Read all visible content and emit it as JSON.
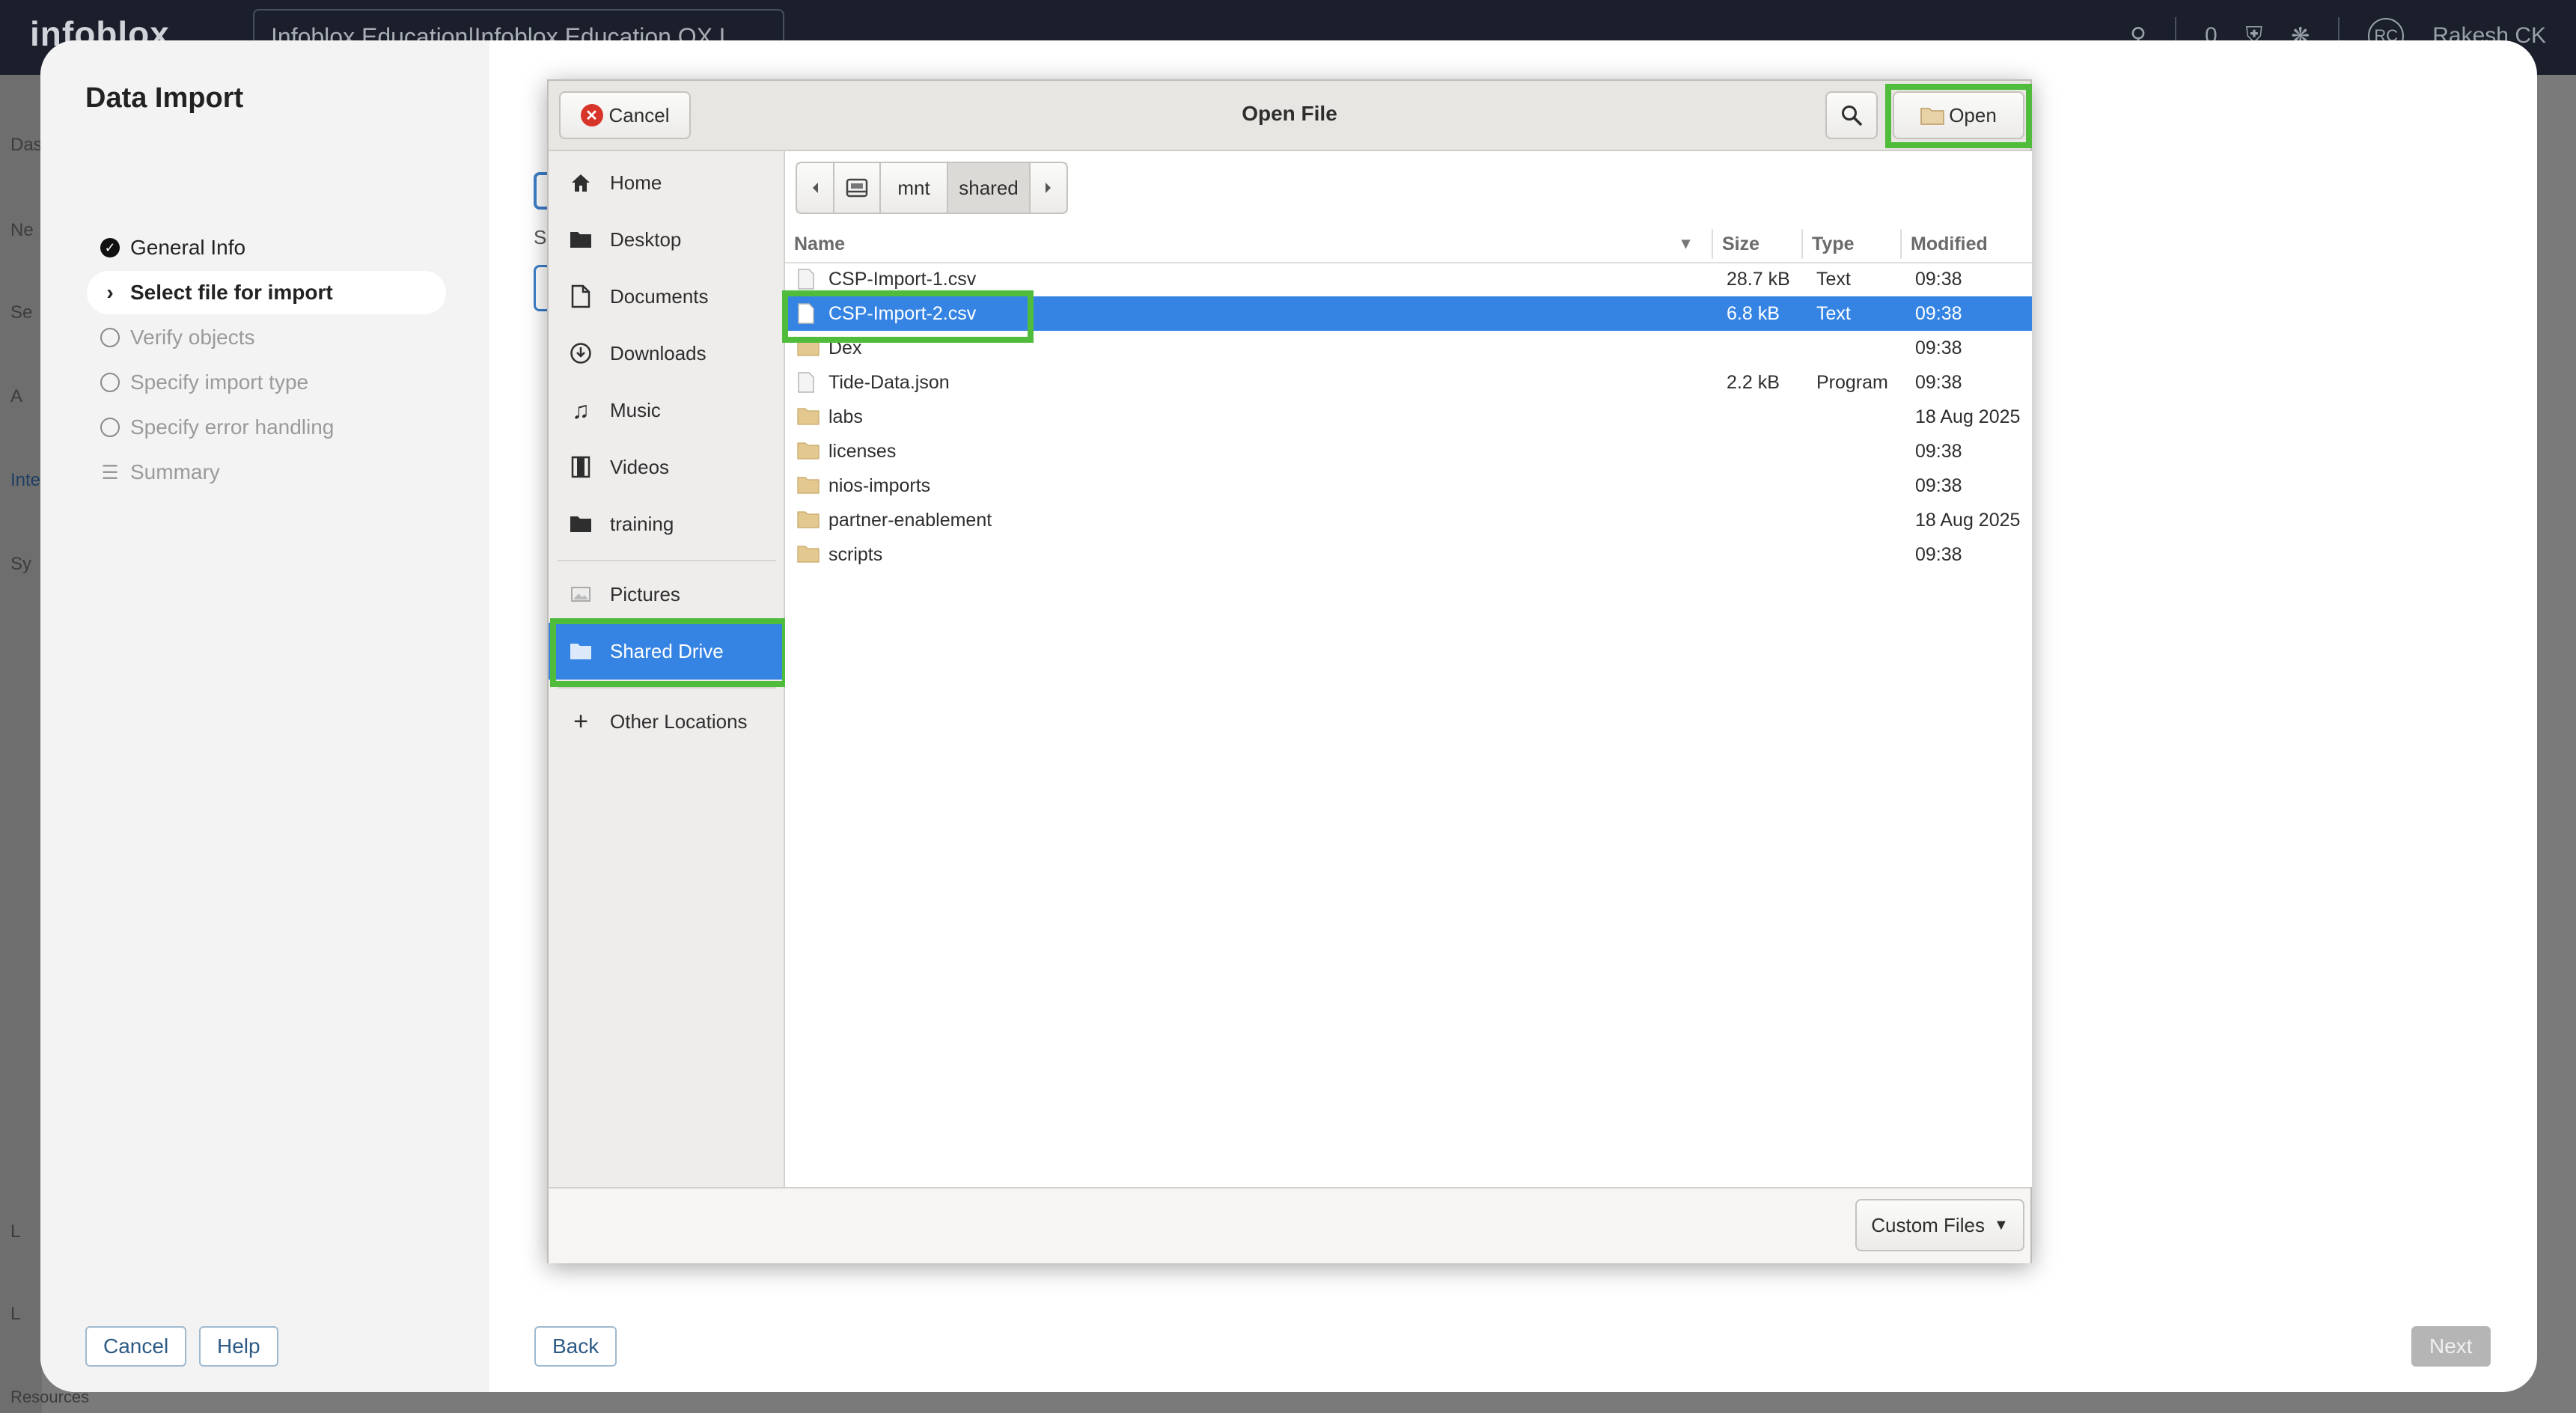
{
  "app": {
    "logo": "infoblox",
    "tenant": "Infoblox Education|Infoblox Education OX.L",
    "notifications_count": "0",
    "user_initials": "RC",
    "user_name": "Rakesh CK"
  },
  "background": {
    "left_nav_fragments": [
      "Das",
      "Ne",
      "Se",
      "A",
      "Inte",
      "Sy",
      "L",
      "L"
    ],
    "footer_text": "Resources"
  },
  "wizard": {
    "title": "Data Import",
    "steps": [
      {
        "label": "General Info",
        "state": "done"
      },
      {
        "label": "Select file for import",
        "state": "active"
      },
      {
        "label": "Verify objects",
        "state": "pending"
      },
      {
        "label": "Specify import type",
        "state": "pending"
      },
      {
        "label": "Specify error handling",
        "state": "pending"
      },
      {
        "label": "Summary",
        "state": "pending"
      }
    ],
    "cancel_label": "Cancel",
    "help_label": "Help",
    "back_label": "Back",
    "next_label": "Next",
    "partial_text": "S"
  },
  "dialog": {
    "title": "Open File",
    "cancel_label": "Cancel",
    "open_label": "Open",
    "filter_label": "Custom Files",
    "places": [
      {
        "label": "Home",
        "icon": "home-icon"
      },
      {
        "label": "Desktop",
        "icon": "folder-icon"
      },
      {
        "label": "Documents",
        "icon": "document-icon"
      },
      {
        "label": "Downloads",
        "icon": "download-icon"
      },
      {
        "label": "Music",
        "icon": "music-icon"
      },
      {
        "label": "Videos",
        "icon": "film-icon"
      },
      {
        "label": "training",
        "icon": "folder-icon"
      },
      {
        "label": "Pictures",
        "icon": "picture-icon"
      },
      {
        "label": "Shared Drive",
        "icon": "folder-icon",
        "selected": true
      },
      {
        "label": "Other Locations",
        "icon": "plus-icon"
      }
    ],
    "path": [
      "mnt",
      "shared"
    ],
    "columns": {
      "name": "Name",
      "size": "Size",
      "type": "Type",
      "modified": "Modified"
    },
    "files": [
      {
        "name": "CSP-Import-1.csv",
        "size": "28.7 kB",
        "type": "Text",
        "modified": "09:38",
        "kind": "file"
      },
      {
        "name": "CSP-Import-2.csv",
        "size": "6.8 kB",
        "type": "Text",
        "modified": "09:38",
        "kind": "file",
        "selected": true
      },
      {
        "name": "Dex",
        "size": "",
        "type": "",
        "modified": "09:38",
        "kind": "folder"
      },
      {
        "name": "Tide-Data.json",
        "size": "2.2 kB",
        "type": "Program",
        "modified": "09:38",
        "kind": "file"
      },
      {
        "name": "labs",
        "size": "",
        "type": "",
        "modified": "18 Aug 2025",
        "kind": "folder"
      },
      {
        "name": "licenses",
        "size": "",
        "type": "",
        "modified": "09:38",
        "kind": "folder"
      },
      {
        "name": "nios-imports",
        "size": "",
        "type": "",
        "modified": "09:38",
        "kind": "folder"
      },
      {
        "name": "partner-enablement",
        "size": "",
        "type": "",
        "modified": "18 Aug 2025",
        "kind": "folder"
      },
      {
        "name": "scripts",
        "size": "",
        "type": "",
        "modified": "09:38",
        "kind": "folder"
      }
    ]
  },
  "colors": {
    "selection": "#3584e4",
    "highlight": "#4fbd3b",
    "topbar": "#1a1f2b"
  }
}
